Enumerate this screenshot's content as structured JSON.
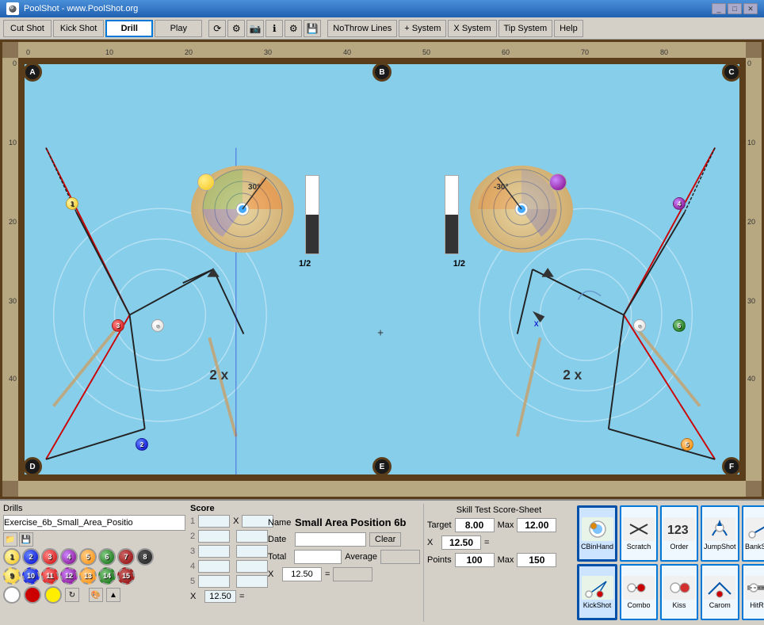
{
  "app": {
    "title": "PoolShot - www.PoolShot.org"
  },
  "toolbar": {
    "cut_shot": "Cut Shot",
    "kick_shot": "Kick Shot",
    "drill": "Drill",
    "play": "Play",
    "no_throw": "NoThrow Lines",
    "plus_system": "+ System",
    "x_system": "X System",
    "tip_system": "Tip System",
    "help": "Help"
  },
  "drills": {
    "label": "Drills",
    "current": "Exercise_6b_Small_Area_Positio",
    "balls": [
      {
        "num": "1",
        "color": "#f5c518"
      },
      {
        "num": "2",
        "color": "#0000cc"
      },
      {
        "num": "3",
        "color": "#cc0000"
      },
      {
        "num": "4",
        "color": "#800080"
      },
      {
        "num": "5",
        "color": "#ff8c00"
      },
      {
        "num": "6",
        "color": "#006400"
      },
      {
        "num": "7",
        "color": "#8b0000"
      },
      {
        "num": "8",
        "color": "#222"
      },
      {
        "num": "9",
        "color": "#f5c518"
      },
      {
        "num": "10",
        "color": "#0000cc"
      },
      {
        "num": "11",
        "color": "#cc0000"
      },
      {
        "num": "12",
        "color": "#800080"
      },
      {
        "num": "13",
        "color": "#ff8c00"
      },
      {
        "num": "14",
        "color": "#006400"
      },
      {
        "num": "15",
        "color": "#8b0000"
      }
    ]
  },
  "score": {
    "label": "Score",
    "rows": [
      {
        "num": "1",
        "x": "X",
        "val": ""
      },
      {
        "num": "2",
        "x": "",
        "val": ""
      },
      {
        "num": "3",
        "x": "",
        "val": ""
      },
      {
        "num": "4",
        "x": "",
        "val": ""
      },
      {
        "num": "5",
        "x": "",
        "val": ""
      }
    ],
    "x_label": "X",
    "x_value": "12.50",
    "eq": "="
  },
  "name_section": {
    "name_label": "Name",
    "name_value": "Small Area Position 6b",
    "date_label": "Date",
    "date_value": "",
    "clear_label": "Clear",
    "total_label": "Total",
    "total_value": "",
    "avg_label": "Average",
    "avg_value": "",
    "x_label": "X",
    "x_value": "12.50",
    "eq": "=",
    "result": ""
  },
  "skill": {
    "title": "Skill Test Score-Sheet",
    "target_label": "Target",
    "target_value": "8.00",
    "max_label": "Max",
    "max_value": "12.00",
    "x_label": "X",
    "x_value": "12.50",
    "eq": "=",
    "points_label": "Points",
    "points_value": "100",
    "points_max_label": "Max",
    "points_max_value": "150"
  },
  "shot_icons": [
    {
      "id": "cbin",
      "label": "CBinHand",
      "icon": "🎱",
      "active": true
    },
    {
      "id": "scratch",
      "label": "Scratch",
      "icon": "✕"
    },
    {
      "id": "order",
      "label": "Order",
      "icon": "123"
    },
    {
      "id": "jumpshot",
      "label": "JumpShot",
      "icon": "↑"
    },
    {
      "id": "bankshot",
      "label": "BankShot",
      "icon": "↗"
    },
    {
      "id": "kickshot",
      "label": "KickShot",
      "icon": "⤵",
      "active": true
    },
    {
      "id": "combo",
      "label": "Combo",
      "icon": "⊕"
    },
    {
      "id": "kiss",
      "label": "Kiss",
      "icon": "◎"
    },
    {
      "id": "carom",
      "label": "Carom",
      "icon": "∠"
    },
    {
      "id": "hitrail",
      "label": "HitRail",
      "icon": "═"
    }
  ],
  "table": {
    "left_angle": "30°",
    "right_angle": "-30°",
    "left_fraction": "1/2",
    "right_fraction": "1/2",
    "left_multiplier": "2 x",
    "right_multiplier": "2 x",
    "pocket_labels": [
      "A",
      "B",
      "C",
      "D",
      "E",
      "F"
    ],
    "rulers": {
      "top": [
        "0",
        "10",
        "20",
        "30",
        "40",
        "50",
        "60",
        "70",
        "80"
      ],
      "right": [
        "0",
        "10",
        "20",
        "30",
        "40"
      ]
    }
  }
}
